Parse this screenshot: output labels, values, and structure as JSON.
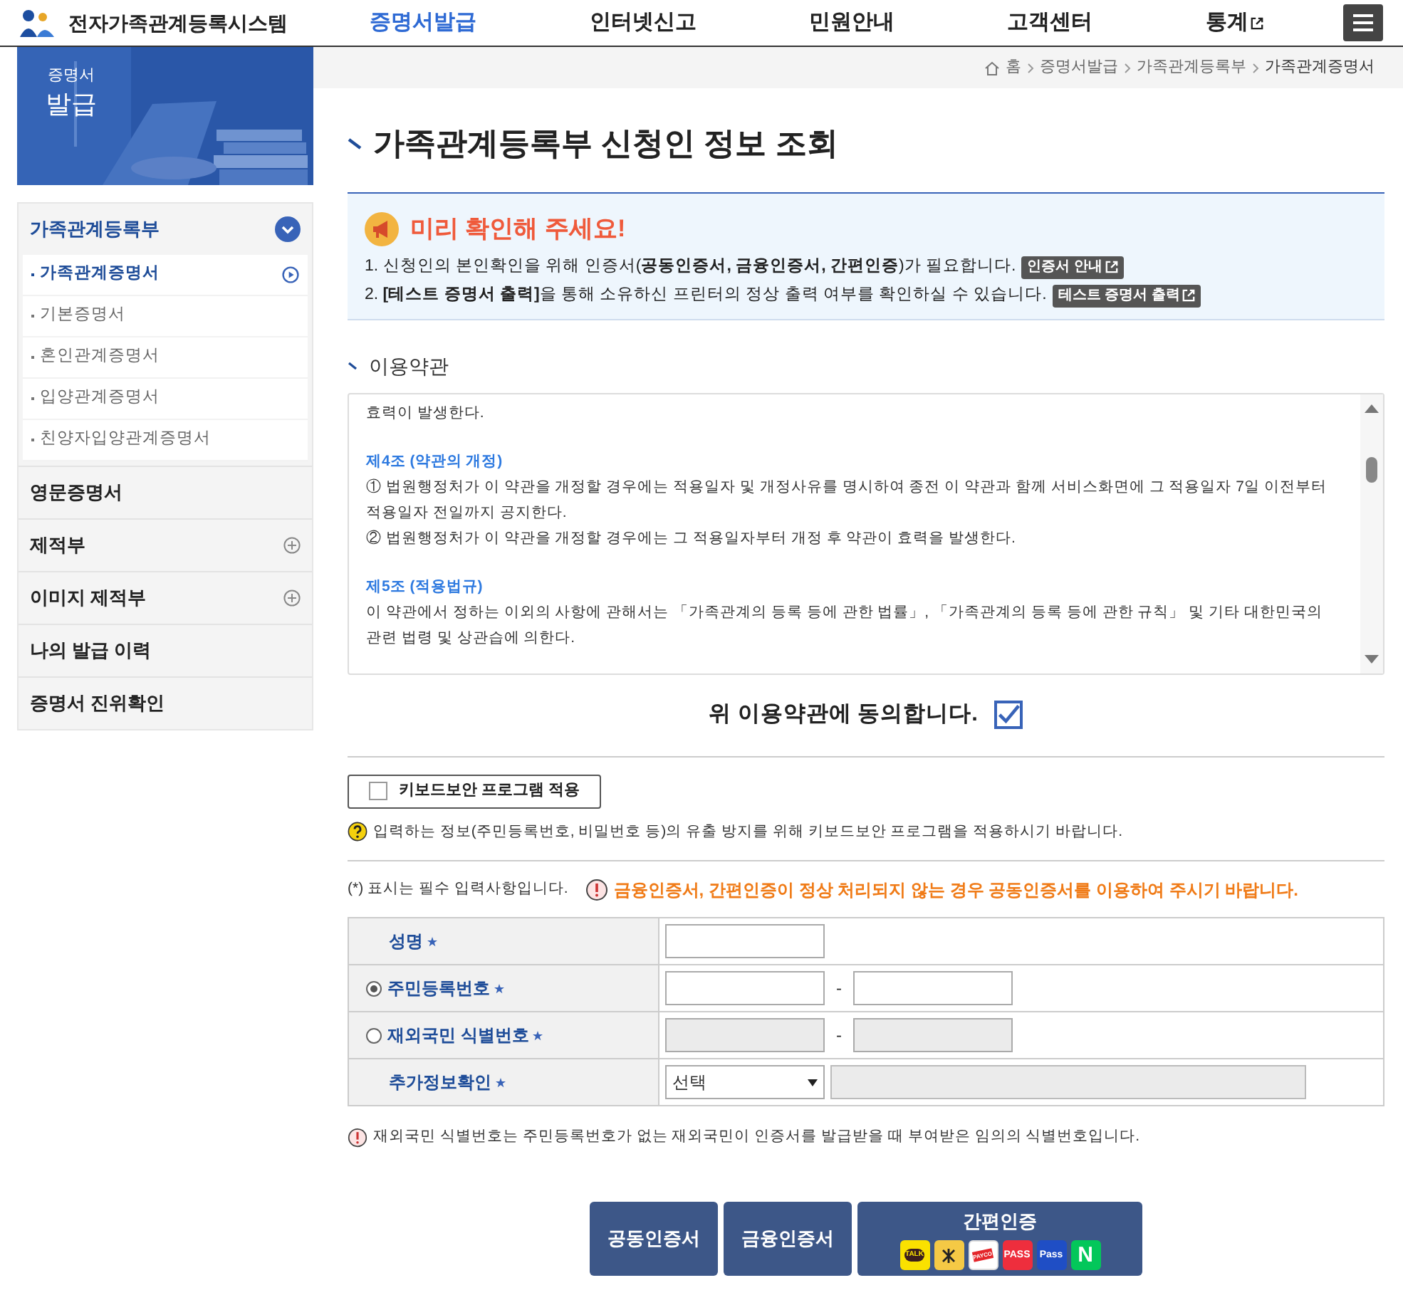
{
  "header": {
    "logo_text": "전자가족관계등록시스템",
    "nav": [
      {
        "label": "증명서발급",
        "selected": true,
        "external": false
      },
      {
        "label": "인터넷신고",
        "selected": false,
        "external": false
      },
      {
        "label": "민원안내",
        "selected": false,
        "external": false
      },
      {
        "label": "고객센터",
        "selected": false,
        "external": false
      },
      {
        "label": "통계",
        "selected": false,
        "external": true
      }
    ]
  },
  "sidebar": {
    "banner_text": [
      "증명서",
      "발급"
    ],
    "items": [
      {
        "label": "가족관계등록부",
        "expandable": true,
        "expanded": true,
        "children": [
          {
            "label": "가족관계증명서",
            "selected": true
          },
          {
            "label": "기본증명서",
            "selected": false
          },
          {
            "label": "혼인관계증명서",
            "selected": false
          },
          {
            "label": "입양관계증명서",
            "selected": false
          },
          {
            "label": "친양자입양관계증명서",
            "selected": false
          }
        ]
      },
      {
        "label": "영문증명서",
        "expandable": false,
        "expanded": false
      },
      {
        "label": "제적부",
        "expandable": true,
        "expanded": false
      },
      {
        "label": "이미지 제적부",
        "expandable": true,
        "expanded": false
      },
      {
        "label": "나의 발급 이력",
        "expandable": false,
        "expanded": false
      },
      {
        "label": "증명서 진위확인",
        "expandable": false,
        "expanded": false
      }
    ]
  },
  "breadcrumb": [
    "홈",
    "증명서발급",
    "가족관계등록부",
    "가족관계증명서"
  ],
  "page_title": "가족관계등록부 신청인 정보 조회",
  "notice": {
    "title": "미리 확인해 주세요!",
    "lines": [
      {
        "text": "1. 신청인의 본인확인을 위해 인증서(**공동인증서, 금융인증서, 간편인증**)가 필요합니다.",
        "button": "인증서 안내"
      },
      {
        "text": "2. **[테스트 증명서 출력]**을 통해 소유하신 프린터의 정상 출력 여부를 확인하실 수 있습니다.",
        "button": "테스트 증명서 출력"
      }
    ]
  },
  "terms": {
    "title": "이용약관",
    "paragraphs": [
      {
        "kind": "text",
        "text": "효력이 발생한다."
      },
      {
        "kind": "heading",
        "text": "제4조 (약관의 개정)"
      },
      {
        "kind": "text",
        "text": "① 법원행정처가 이 약관을 개정할 경우에는 적용일자 및 개정사유를 명시하여 종전 이 약관과 함께 서비스화면에 그 적용일자 7일 이전부터 적용일자 전일까지 공지한다."
      },
      {
        "kind": "text",
        "text": "② 법원행정처가 이 약관을 개정할 경우에는 그 적용일자부터 개정 후 약관이 효력을 발생한다."
      },
      {
        "kind": "heading",
        "text": "제5조 (적용법규)"
      },
      {
        "kind": "text",
        "text": "이 약관에서 정하는 이외의 사항에 관해서는 「가족관계의 등록 등에 관한 법률」, 「가족관계의 등록 등에 관한 규칙」 및 기타 대한민국의 관련 법령 및 상관습에 의한다."
      }
    ]
  },
  "agree": {
    "label": "위 이용약관에 동의합니다.",
    "checked": true
  },
  "keyboard_security": {
    "label": "키보드보안 프로그램 적용",
    "checked": false,
    "hint": "입력하는 정보(주민등록번호, 비밀번호 등)의 유출 방지를 위해 키보드보안 프로그램을 적용하시기 바랍니다."
  },
  "required_note": "(*) 표시는 필수 입력사항입니다.",
  "warning": "금융인증서, 간편인증이 정상 처리되지 않는 경우 공동인증서를 이용하여 주시기 바랍니다.",
  "form": [
    {
      "kind": "text",
      "label": "성명"
    },
    {
      "kind": "radio_pair",
      "label": "주민등록번호",
      "selected": true,
      "separator": "-"
    },
    {
      "kind": "radio_pair",
      "label": "재외국민 식별번호",
      "selected": false,
      "separator": "-"
    },
    {
      "kind": "select",
      "label": "추가정보확인",
      "value": "선택"
    }
  ],
  "footnote": "재외국민 식별번호는 주민등록번호가 없는 재외국민이 인증서를 발급받을 때 부여받은 임의의 식별번호입니다.",
  "buttons": [
    {
      "kind": "plain",
      "label": "공동인증서"
    },
    {
      "kind": "plain",
      "label": "금융인증서"
    },
    {
      "kind": "easy",
      "label": "간편인증",
      "providers": [
        {
          "kind": "bubble",
          "label": "TALK",
          "color": "#fae100"
        },
        {
          "kind": "star",
          "color": "#f5c945"
        },
        {
          "kind": "band",
          "label": "PAYCO",
          "color": "#ffffff"
        },
        {
          "kind": "text",
          "label": "PASS",
          "color": "#ee2e3d"
        },
        {
          "kind": "text",
          "label": "Pass",
          "color": "#1f4ec5"
        },
        {
          "kind": "text",
          "label": "N",
          "color": "#03c75a"
        }
      ]
    }
  ]
}
